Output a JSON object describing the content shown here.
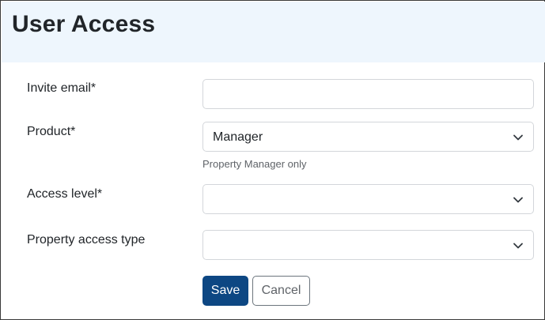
{
  "header": {
    "title": "User Access"
  },
  "form": {
    "invite_email": {
      "label": "Invite email*",
      "value": "",
      "placeholder": ""
    },
    "product": {
      "label": "Product*",
      "selected": "Manager",
      "help": "Property Manager only"
    },
    "access_level": {
      "label": "Access level*",
      "selected": ""
    },
    "property_access_type": {
      "label": "Property access type",
      "selected": ""
    }
  },
  "actions": {
    "save_label": "Save",
    "cancel_label": "Cancel"
  },
  "colors": {
    "header_bg": "#eef6fd",
    "primary": "#0d4783",
    "text": "#212529",
    "muted": "#5f6368",
    "border": "#d3d6da"
  }
}
